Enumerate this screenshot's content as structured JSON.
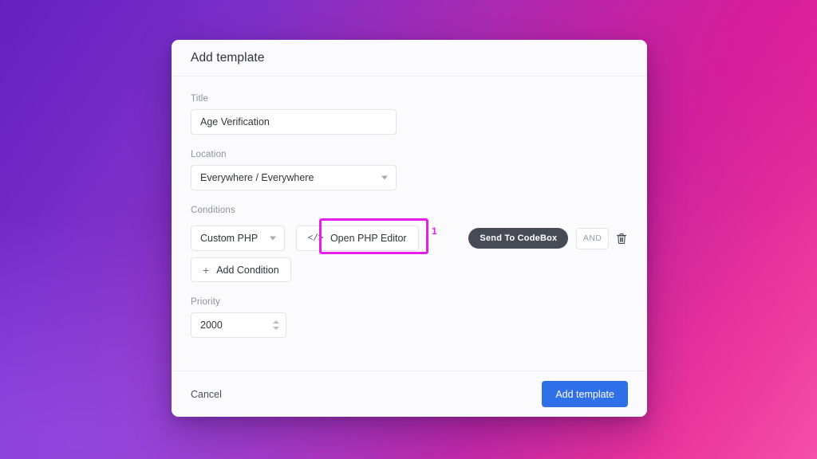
{
  "dialog": {
    "title": "Add template",
    "fields": {
      "title": {
        "label": "Title",
        "value": "Age Verification",
        "placeholder": "Title"
      },
      "location": {
        "label": "Location",
        "value": "Everywhere / Everywhere"
      },
      "conditions": {
        "label": "Conditions",
        "type_value": "Custom PHP",
        "php_editor_label": "Open PHP Editor",
        "php_editor_icon": "code-icon",
        "codebox_label": "Send To CodeBox",
        "operator_label": "AND",
        "delete_icon": "trash-icon",
        "add_condition_label": "Add Condition",
        "add_condition_icon": "plus-icon"
      },
      "priority": {
        "label": "Priority",
        "value": "2000"
      }
    },
    "footer": {
      "cancel_label": "Cancel",
      "submit_label": "Add template"
    }
  },
  "annotation": {
    "number": "1",
    "color": "#e81ee8",
    "target": "Open PHP Editor"
  },
  "theme": {
    "primary_button": "#2f6fe8",
    "codebox_button": "#474b56",
    "highlight": "#e81ee8",
    "background_gradient_start": "#6320c0",
    "background_gradient_end": "#f54fa8"
  }
}
